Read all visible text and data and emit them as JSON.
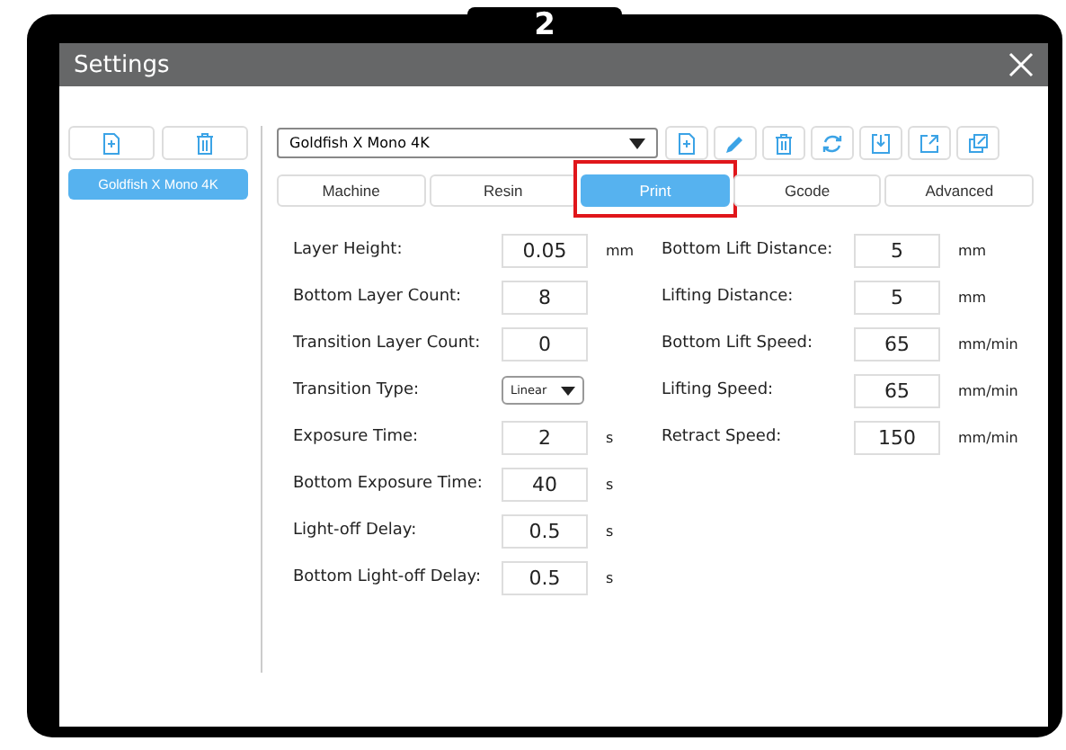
{
  "badge": "2",
  "window": {
    "title": "Settings"
  },
  "sidebar": {
    "profiles": [
      {
        "label": "Goldfish X Mono 4K",
        "selected": true
      }
    ]
  },
  "profile_select": {
    "value": "Goldfish X Mono 4K"
  },
  "tabs": [
    {
      "label": "Machine",
      "selected": false,
      "highlighted": false
    },
    {
      "label": "Resin",
      "selected": false,
      "highlighted": false
    },
    {
      "label": "Print",
      "selected": true,
      "highlighted": true
    },
    {
      "label": "Gcode",
      "selected": false,
      "highlighted": false
    },
    {
      "label": "Advanced",
      "selected": false,
      "highlighted": false
    }
  ],
  "fields_left": [
    {
      "kind": "input",
      "label": "Layer Height:",
      "value": "0.05",
      "unit": "mm"
    },
    {
      "kind": "input",
      "label": "Bottom Layer Count:",
      "value": "8"
    },
    {
      "kind": "input",
      "label": "Transition Layer Count:",
      "value": "0"
    },
    {
      "kind": "select",
      "label": "Transition Type:",
      "value": "Linear"
    },
    {
      "kind": "input",
      "label": "Exposure Time:",
      "value": "2",
      "unit": "s"
    },
    {
      "kind": "input",
      "label": "Bottom Exposure Time:",
      "value": "40",
      "unit": "s"
    },
    {
      "kind": "input",
      "label": "Light-off Delay:",
      "value": "0.5",
      "unit": "s"
    },
    {
      "kind": "input",
      "label": "Bottom Light-off Delay:",
      "value": "0.5",
      "unit": "s"
    }
  ],
  "fields_right": [
    {
      "kind": "input",
      "label": "Bottom Lift Distance:",
      "value": "5",
      "unit": "mm"
    },
    {
      "kind": "input",
      "label": "Lifting Distance:",
      "value": "5",
      "unit": "mm"
    },
    {
      "kind": "input",
      "label": "Bottom Lift Speed:",
      "value": "65",
      "unit": "mm/min"
    },
    {
      "kind": "input",
      "label": "Lifting Speed:",
      "value": "65",
      "unit": "mm/min"
    },
    {
      "kind": "input",
      "label": "Retract Speed:",
      "value": "150",
      "unit": "mm/min"
    }
  ]
}
